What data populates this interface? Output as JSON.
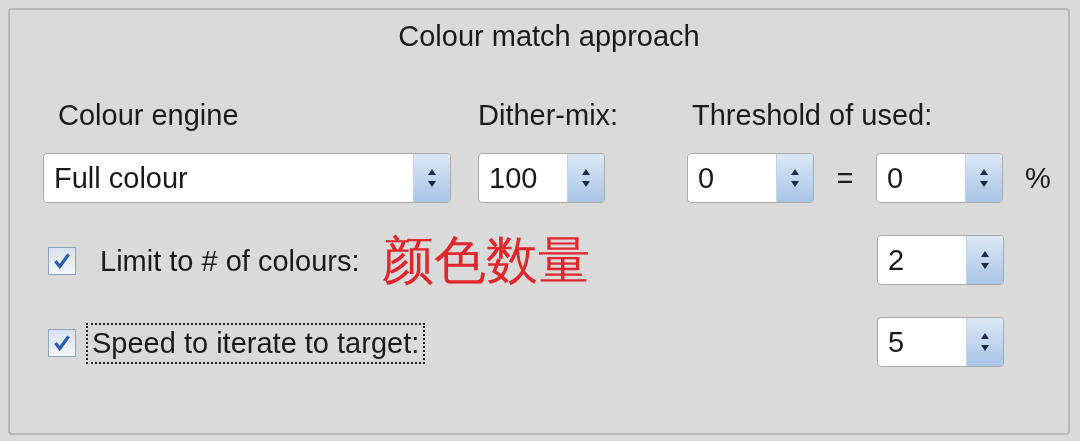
{
  "group_title": "Colour match approach",
  "colour_engine": {
    "label": "Colour engine",
    "value": "Full colour"
  },
  "dither_mix": {
    "label": "Dither-mix:",
    "value": "100"
  },
  "threshold": {
    "label": "Threshold of used:",
    "value": "0",
    "equals": "=",
    "percent_value": "0",
    "unit": "%"
  },
  "options": [
    {
      "label": "Limit to # of colours:",
      "checked": true,
      "focused": false,
      "value": "2",
      "annotation": "颜色数量"
    },
    {
      "label": "Speed to iterate to target:",
      "checked": true,
      "focused": true,
      "value": "5"
    }
  ]
}
